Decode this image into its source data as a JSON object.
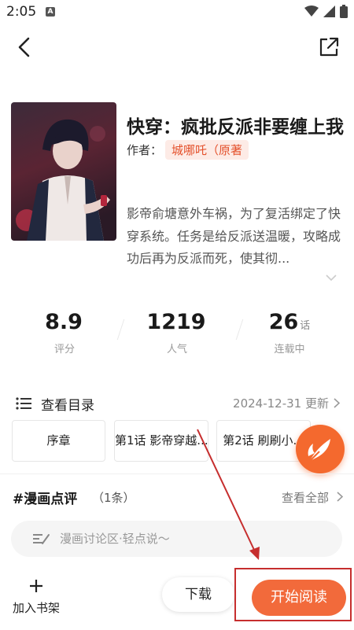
{
  "status_bar": {
    "time": "2:05",
    "notification_icon": "a-icon",
    "icons": [
      "wifi-icon",
      "signal-icon",
      "battery-icon"
    ]
  },
  "nav": {
    "back_icon": "chevron-left-icon",
    "share_icon": "share-icon"
  },
  "book": {
    "title": "快穿：疯批反派非要缠上我",
    "author_label": "作者：",
    "author": "城哪吒（原著",
    "description": "影帝俞塘意外车祸，为了复活绑定了快穿系统。任务是给反派送温暖，攻略成功后再为反派而死，使其彻..."
  },
  "stats": [
    {
      "value": "8.9",
      "unit": "",
      "label": "评分"
    },
    {
      "value": "1219",
      "unit": "",
      "label": "人气"
    },
    {
      "value": "26",
      "unit": "话",
      "label": "连载中"
    }
  ],
  "catalog": {
    "title": "查看目录",
    "updated": "2024-12-31 更新"
  },
  "chapters": [
    "序章",
    "第1话 影帝穿越...",
    "第2话 刷刷小..."
  ],
  "review": {
    "title": "#漫画点评",
    "count": "（1条）",
    "view_all": "查看全部"
  },
  "comment": {
    "placeholder": "漫画讨论区·轻点说～"
  },
  "bottom": {
    "shelf_label": "加入书架",
    "download_label": "下载",
    "read_label": "开始阅读"
  },
  "colors": {
    "accent": "#f26a3b",
    "annotation": "#c62e2e",
    "author_tag_bg": "#fdebe6"
  }
}
